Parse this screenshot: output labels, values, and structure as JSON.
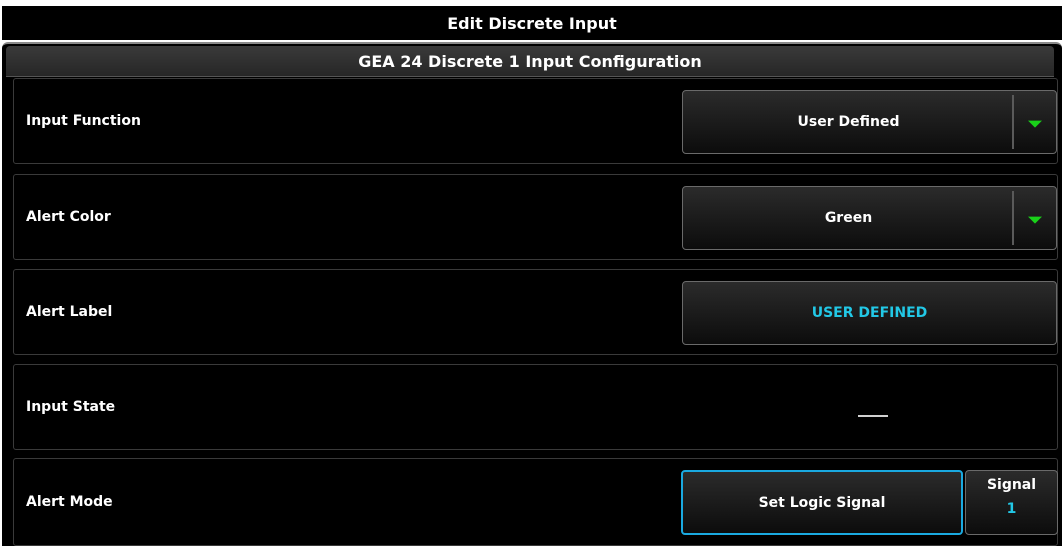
{
  "window": {
    "title": "Edit Discrete Input"
  },
  "panel": {
    "header": "GEA 24 Discrete 1 Input Configuration"
  },
  "rows": [
    {
      "label": "Input Function",
      "value": "User Defined"
    },
    {
      "label": "Alert Color",
      "value": "Green"
    },
    {
      "label": "Alert Label",
      "value": "USER DEFINED"
    },
    {
      "label": "Input State",
      "value": ""
    },
    {
      "label": "Alert Mode",
      "value": "Set Logic Signal",
      "signal_label": "Signal",
      "signal_value": "1"
    }
  ],
  "colors": {
    "background": "#000000",
    "accent_cyan": "#22c8e6",
    "dropdown_arrow_green": "#19d119",
    "selection_border": "#1aa9e0"
  },
  "icons": {
    "dropdown_arrow": "triangle-down"
  }
}
